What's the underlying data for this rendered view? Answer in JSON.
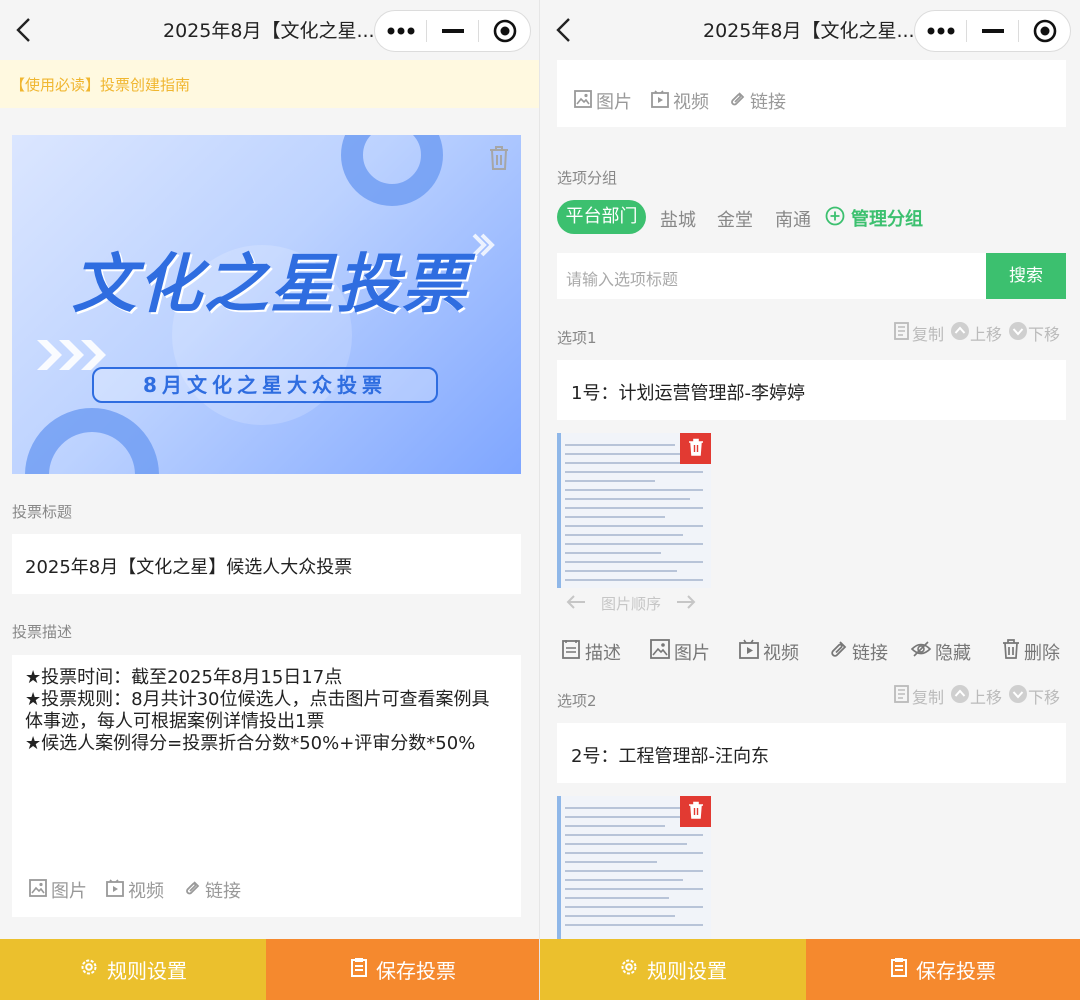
{
  "nav": {
    "title": "2025年8月【文化之星..."
  },
  "left": {
    "notice": "【使用必读】投票创建指南",
    "banner": {
      "title": "文化之星投票",
      "subtitle": "8月文化之星大众投票"
    },
    "title_label": "投票标题",
    "title_value": "2025年8月【文化之星】候选人大众投票",
    "desc_label": "投票描述",
    "desc_lines": [
      "★投票时间：截至2025年8月15日17点",
      "★投票规则：8月共计30位候选人，点击图片可查看案例具",
      "体事迹，每人可根据案例详情投出1票",
      "★候选人案例得分=投票折合分数*50%+评审分数*50%"
    ],
    "tools": {
      "image": "图片",
      "video": "视频",
      "link": "链接"
    }
  },
  "right": {
    "tools": {
      "image": "图片",
      "video": "视频",
      "link": "链接"
    },
    "group_label": "选项分组",
    "groups": [
      "平台部门",
      "盐城",
      "金堂",
      "南通"
    ],
    "manage_groups": "管理分组",
    "search_placeholder": "请输入选项标题",
    "search_button": "搜索",
    "ops": {
      "copy": "复制",
      "up": "上移",
      "down": "下移"
    },
    "image_order": "图片顺序",
    "option_tools": {
      "desc": "描述",
      "image": "图片",
      "video": "视频",
      "link": "链接",
      "hide": "隐藏",
      "delete": "删除"
    },
    "options": [
      {
        "label": "选项1",
        "title": "1号：计划运营管理部-李婷婷"
      },
      {
        "label": "选项2",
        "title": "2号：工程管理部-汪向东"
      }
    ]
  },
  "bottom": {
    "rules": "规则设置",
    "save": "保存投票"
  },
  "colors": {
    "green": "#3cc06f",
    "yellow": "#ebc02d",
    "orange": "#f5892e",
    "red": "#e23a32",
    "notice": "#f0b630"
  }
}
